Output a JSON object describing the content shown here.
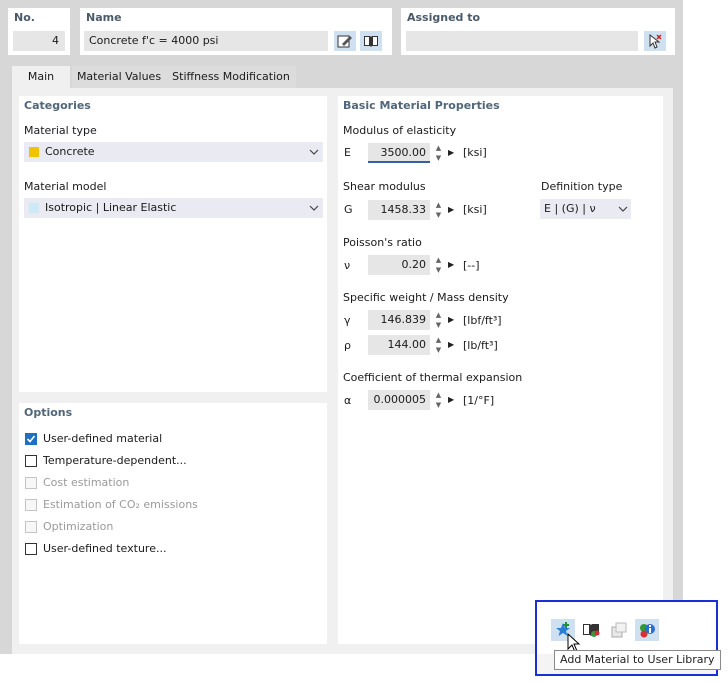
{
  "header": {
    "no_label": "No.",
    "no_value": "4",
    "name_label": "Name",
    "name_value": "Concrete f'c = 4000 psi",
    "assigned_label": "Assigned to",
    "assigned_value": ""
  },
  "tabs": [
    {
      "label": "Main"
    },
    {
      "label": "Material Values"
    },
    {
      "label": "Stiffness Modification"
    }
  ],
  "categories": {
    "title": "Categories",
    "material_type_label": "Material type",
    "material_type_value": "Concrete",
    "material_type_color": "#f2c100",
    "material_model_label": "Material model",
    "material_model_value": "Isotropic | Linear Elastic",
    "material_model_color": "#cde9f7"
  },
  "options": {
    "title": "Options",
    "items": [
      {
        "label": "User-defined material",
        "checked": true,
        "enabled": true
      },
      {
        "label": "Temperature-dependent...",
        "checked": false,
        "enabled": true
      },
      {
        "label": "Cost estimation",
        "checked": false,
        "enabled": false
      },
      {
        "label": "Estimation of CO₂ emissions",
        "checked": false,
        "enabled": false
      },
      {
        "label": "Optimization",
        "checked": false,
        "enabled": false
      },
      {
        "label": "User-defined texture...",
        "checked": false,
        "enabled": true
      }
    ]
  },
  "basic": {
    "title": "Basic Material Properties",
    "modulus_label": "Modulus of elasticity",
    "E_symbol": "E",
    "E_value": "3500.00",
    "E_unit": "[ksi]",
    "shear_label": "Shear modulus",
    "G_symbol": "G",
    "G_value": "1458.33",
    "G_unit": "[ksi]",
    "deftype_label": "Definition type",
    "deftype_value": "E | (G) | ν",
    "poisson_label": "Poisson's ratio",
    "nu_symbol": "ν",
    "nu_value": "0.20",
    "nu_unit": "[--]",
    "weight_label": "Specific weight / Mass density",
    "gamma_symbol": "γ",
    "gamma_value": "146.839",
    "gamma_unit": "[lbf/ft³]",
    "rho_symbol": "ρ",
    "rho_value": "144.00",
    "rho_unit": "[lb/ft³]",
    "thermal_label": "Coefficient of thermal expansion",
    "alpha_symbol": "α",
    "alpha_value": "0.000005",
    "alpha_unit": "[1/°F]"
  },
  "toolbar": {
    "tooltip": "Add Material to User Library",
    "icons": [
      "add-to-user-library-icon",
      "material-library-icon",
      "copy-material-icon",
      "material-info-icon"
    ],
    "highlight_color": "#1a2fd6"
  }
}
